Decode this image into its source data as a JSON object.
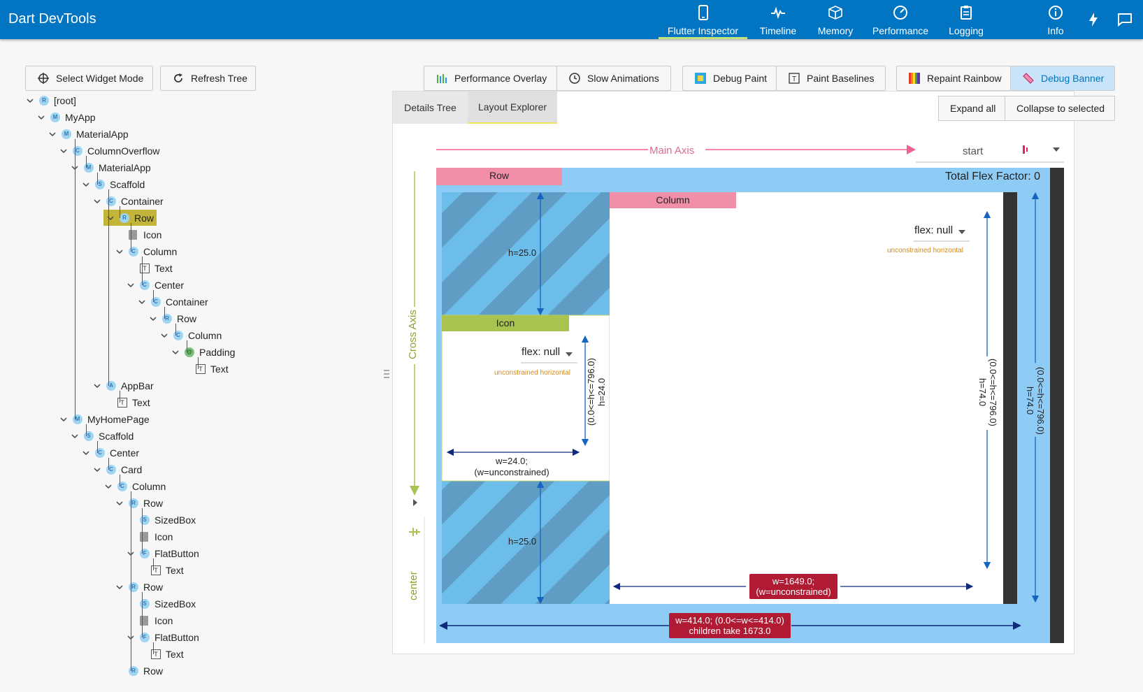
{
  "app": {
    "title": "Dart DevTools"
  },
  "nav": {
    "tabs": [
      {
        "label": "Flutter Inspector",
        "icon": "phone-icon",
        "active": true
      },
      {
        "label": "Timeline",
        "icon": "timeline-icon"
      },
      {
        "label": "Memory",
        "icon": "memory-icon"
      },
      {
        "label": "Performance",
        "icon": "performance-icon"
      },
      {
        "label": "Logging",
        "icon": "logging-icon"
      },
      {
        "label": "Info",
        "icon": "info-icon"
      }
    ],
    "extra_icons": [
      "hot-reload-icon",
      "feedback-icon"
    ]
  },
  "toolbar": {
    "select_widget_mode": "Select Widget Mode",
    "refresh_tree": "Refresh Tree",
    "performance_overlay": "Performance Overlay",
    "slow_animations": "Slow Animations",
    "debug_paint": "Debug Paint",
    "paint_baselines": "Paint Baselines",
    "repaint_rainbow": "Repaint Rainbow",
    "debug_banner": "Debug Banner"
  },
  "tree": {
    "nodes": [
      {
        "label": "[root]",
        "badge": "R",
        "kind": "circle",
        "depth": 0
      },
      {
        "label": "MyApp",
        "badge": "M",
        "kind": "circle",
        "depth": 1
      },
      {
        "label": "MaterialApp",
        "badge": "M",
        "kind": "circle",
        "depth": 2
      },
      {
        "label": "ColumnOverflow",
        "badge": "C",
        "kind": "circle",
        "depth": 3
      },
      {
        "label": "MaterialApp",
        "badge": "M",
        "kind": "circle",
        "depth": 4
      },
      {
        "label": "Scaffold",
        "badge": "S",
        "kind": "circle",
        "depth": 5
      },
      {
        "label": "Container",
        "badge": "C",
        "kind": "circle",
        "depth": 6
      },
      {
        "label": "Row",
        "badge": "R",
        "kind": "circle",
        "depth": 7,
        "selected": true
      },
      {
        "label": "Icon",
        "badge": "",
        "kind": "file",
        "depth": 8
      },
      {
        "label": "Column",
        "badge": "C",
        "kind": "circle",
        "depth": 8
      },
      {
        "label": "Text",
        "badge": "T",
        "kind": "text",
        "depth": 9
      },
      {
        "label": "Center",
        "badge": "C",
        "kind": "circle",
        "depth": 9
      },
      {
        "label": "Container",
        "badge": "C",
        "kind": "circle",
        "depth": 10
      },
      {
        "label": "Row",
        "badge": "R",
        "kind": "circle",
        "depth": 11
      },
      {
        "label": "Column",
        "badge": "C",
        "kind": "circle",
        "depth": 12
      },
      {
        "label": "Padding",
        "badge": "@",
        "kind": "green",
        "depth": 13
      },
      {
        "label": "Text",
        "badge": "T",
        "kind": "text",
        "depth": 14
      },
      {
        "label": "AppBar",
        "badge": "A",
        "kind": "circle",
        "depth": 6
      },
      {
        "label": "Text",
        "badge": "T",
        "kind": "text",
        "depth": 7
      },
      {
        "label": "MyHomePage",
        "badge": "M",
        "kind": "circle",
        "depth": 3
      },
      {
        "label": "Scaffold",
        "badge": "S",
        "kind": "circle",
        "depth": 4
      },
      {
        "label": "Center",
        "badge": "C",
        "kind": "circle",
        "depth": 5
      },
      {
        "label": "Card",
        "badge": "C",
        "kind": "circle",
        "depth": 6
      },
      {
        "label": "Column",
        "badge": "C",
        "kind": "circle",
        "depth": 7
      },
      {
        "label": "Row",
        "badge": "R",
        "kind": "circle",
        "depth": 8
      },
      {
        "label": "SizedBox",
        "badge": "S",
        "kind": "circle",
        "depth": 9
      },
      {
        "label": "Icon",
        "badge": "",
        "kind": "file",
        "depth": 9
      },
      {
        "label": "FlatButton",
        "badge": "F",
        "kind": "circle",
        "depth": 9
      },
      {
        "label": "Text",
        "badge": "T",
        "kind": "text",
        "depth": 10
      },
      {
        "label": "Row",
        "badge": "R",
        "kind": "circle",
        "depth": 8
      },
      {
        "label": "SizedBox",
        "badge": "S",
        "kind": "circle",
        "depth": 9
      },
      {
        "label": "Icon",
        "badge": "",
        "kind": "file",
        "depth": 9
      },
      {
        "label": "FlatButton",
        "badge": "F",
        "kind": "circle",
        "depth": 9
      },
      {
        "label": "Text",
        "badge": "T",
        "kind": "text",
        "depth": 10
      },
      {
        "label": "Row",
        "badge": "R",
        "kind": "circle",
        "depth": 8
      }
    ]
  },
  "details": {
    "tabs": [
      "Details Tree",
      "Layout Explorer"
    ],
    "active_tab": "Layout Explorer",
    "expand_all": "Expand all",
    "collapse_to_selected": "Collapse to selected"
  },
  "layout": {
    "main_axis_label": "Main Axis",
    "main_axis_value": "start",
    "cross_axis_label": "Cross Axis",
    "cross_axis_value": "center",
    "row_label": "Row",
    "total_flex": "Total Flex Factor: 0",
    "column_label": "Column",
    "icon_label": "Icon",
    "flex_null": "flex: null",
    "unconstrained_horizontal": "unconstrained horizontal",
    "h_top": "h=25.0",
    "h_bottom": "h=25.0",
    "icon_h_line1": "h=24.0",
    "icon_h_line2": "(0.0<=h<=796.0)",
    "icon_w_line1": "w=24.0;",
    "icon_w_line2": "(w=unconstrained)",
    "col_h_line1": "h=74.0",
    "col_h_line2": "(0.0<=h<=796.0)",
    "col_w_line1": "w=1649.0;",
    "col_w_line2": "(w=unconstrained)",
    "row_h_line1": "h=74.0",
    "row_h_line2": "(0.0<=h<=796.0)",
    "row_w_line1": "w=414.0; (0.0<=w<=414.0)",
    "row_w_line2": "children take 1673.0"
  },
  "colors": {
    "brand": "#0175c2",
    "accent": "#c3e37e",
    "pink": "#f28fa8",
    "light_blue": "#8ecbf5",
    "mid_blue": "#6cb8e6",
    "stripe": "#5d97bd",
    "olive": "#a8c34f",
    "error": "#b01a32"
  }
}
